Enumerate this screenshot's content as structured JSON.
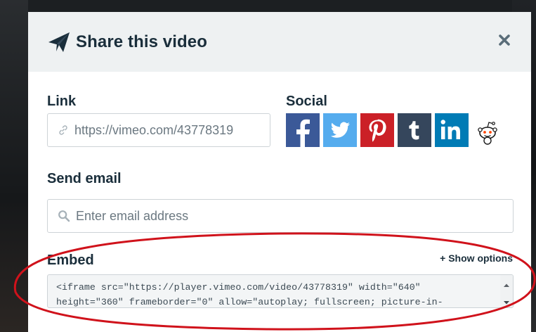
{
  "modal": {
    "title": "Share this video",
    "close_icon": "close-icon"
  },
  "link": {
    "label": "Link",
    "url": "https://vimeo.com/43778319"
  },
  "social": {
    "label": "Social",
    "networks": [
      {
        "name": "facebook",
        "glyph": "f"
      },
      {
        "name": "twitter",
        "glyph": ""
      },
      {
        "name": "pinterest",
        "glyph": "p"
      },
      {
        "name": "tumblr",
        "glyph": "t"
      },
      {
        "name": "linkedin",
        "glyph": "in"
      },
      {
        "name": "reddit",
        "glyph": ""
      }
    ]
  },
  "email": {
    "label": "Send email",
    "placeholder": "Enter email address"
  },
  "embed": {
    "label": "Embed",
    "show_options": "+ Show options",
    "code_line1": "<iframe src=\"https://player.vimeo.com/video/43778319\" width=\"640\"",
    "code_line2": "height=\"360\" frameborder=\"0\" allow=\"autoplay; fullscreen; picture-in-"
  },
  "colors": {
    "annotation": "#d0121b",
    "title": "#1a2e3b",
    "header_bg": "#eef1f2"
  }
}
